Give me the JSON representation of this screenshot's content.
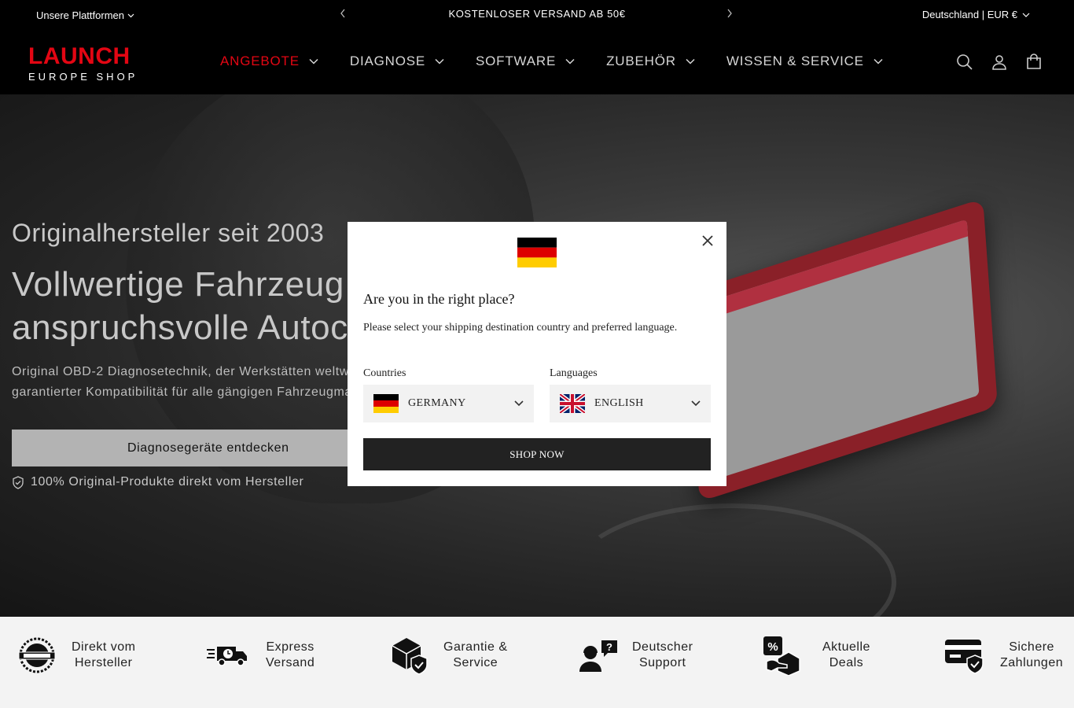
{
  "topbar": {
    "platforms_label": "Unsere Plattformen",
    "announcement": "KOSTENLOSER VERSAND AB 50€",
    "locale_label": "Deutschland | EUR €"
  },
  "header": {
    "logo_top": "LAUNCH",
    "logo_bottom": "EUROPE SHOP",
    "nav": [
      {
        "label": "ANGEBOTE",
        "active": true
      },
      {
        "label": "DIAGNOSE"
      },
      {
        "label": "SOFTWARE"
      },
      {
        "label": "ZUBEHÖR"
      },
      {
        "label": "WISSEN & SERVICE"
      }
    ],
    "icons": [
      "search-icon",
      "account-icon",
      "cart-icon"
    ]
  },
  "hero": {
    "kicker": "Originalhersteller seit 2003",
    "headline_line1": "Vollwertige Fahrzeug",
    "headline_line2": "anspruchsvolle Autoc",
    "sub_line1": "Original OBD-2 Diagnosetechnik, der Werkstätten weltw",
    "sub_line2": "garantierter Kompatibilität für alle gängigen Fahrzeugma",
    "cta_label": "Diagnosegeräte entdecken",
    "guarantee": "100% Original-Produkte direkt vom Hersteller"
  },
  "features": [
    {
      "line1": "Direkt vom",
      "line2": "Hersteller",
      "icon": "original-product-seal-icon"
    },
    {
      "line1": "Express",
      "line2": "Versand",
      "icon": "delivery-truck-icon"
    },
    {
      "line1": "Garantie &",
      "line2": "Service",
      "icon": "package-shield-icon"
    },
    {
      "line1": "Deutscher",
      "line2": "Support",
      "icon": "support-agent-icon"
    },
    {
      "line1": "Aktuelle",
      "line2": "Deals",
      "icon": "discount-box-icon"
    },
    {
      "line1": "Sichere",
      "line2": "Zahlungen",
      "icon": "secure-card-icon"
    }
  ],
  "modal": {
    "title": "Are you in the right place?",
    "description": "Please select your shipping destination country and preferred language.",
    "countries_label": "Countries",
    "country_value": "GERMANY",
    "languages_label": "Languages",
    "language_value": "ENGLISH",
    "shop_button": "SHOP NOW"
  },
  "colors": {
    "brand_red": "#e30613",
    "topbar_bg": "#000000",
    "modal_button": "#222222"
  }
}
